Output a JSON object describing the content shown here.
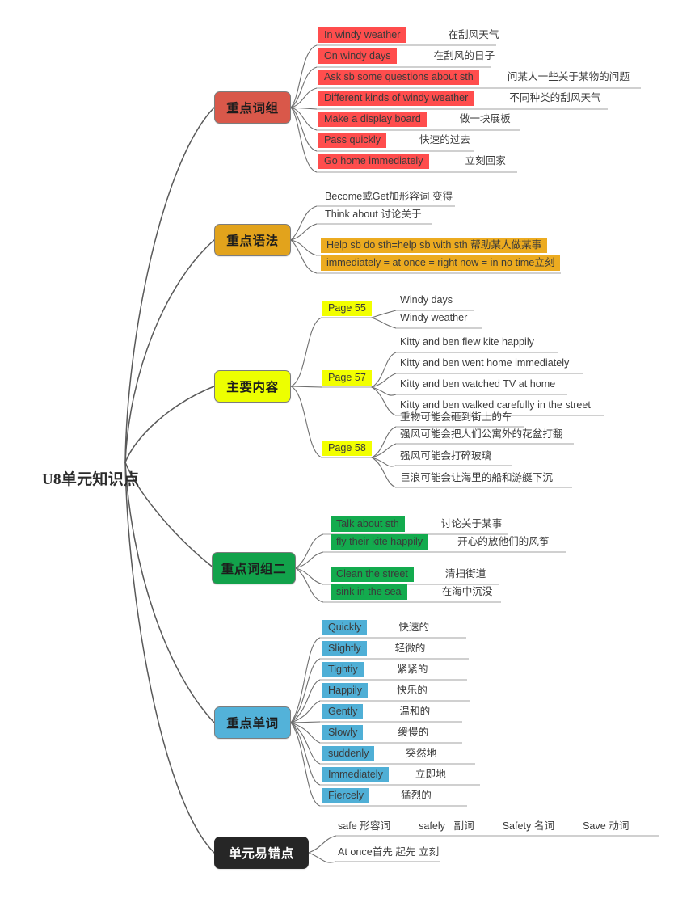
{
  "root": {
    "label": "U8单元知识点"
  },
  "palette": {
    "red_node": "#D9584A",
    "orange_node": "#E2A31C",
    "yellow_node": "#EDFF00",
    "green_node": "#12A24B",
    "blue_node": "#53B2D9",
    "black_node": "#262626",
    "red_highlight": "#FF4D4D",
    "orange_highlight": "#ECAB20",
    "yellow_highlight": "#F2FF00",
    "green_highlight": "#13AB4E",
    "blue_highlight": "#4FAFD6",
    "line": "#6b6b6b",
    "underline": "#9a9a9a",
    "text": "#3b3b3b"
  },
  "branches": [
    {
      "id": "key-phrases",
      "title": "重点词组",
      "items": [
        {
          "en": "In windy weather",
          "cn": "在刮风天气"
        },
        {
          "en": "On windy days",
          "cn": "在刮风的日子"
        },
        {
          "en": "Ask sb some questions about sth",
          "cn": "问某人一些关于某物的问题"
        },
        {
          "en": "Different kinds of windy weather",
          "cn": "不同种类的刮风天气"
        },
        {
          "en": "Make a display  board",
          "cn": "做一块展板"
        },
        {
          "en": "Pass quickly",
          "cn": "快速的过去"
        },
        {
          "en": "Go home immediately",
          "cn": "立刻回家"
        }
      ]
    },
    {
      "id": "key-grammar",
      "title": "重点语法",
      "items": [
        {
          "en": "Become或Get加形容词 变得",
          "cn": ""
        },
        {
          "en": "Think about 讨论关于",
          "cn": ""
        },
        {
          "en": "Help sb do sth=help sb with sth 帮助某人做某事",
          "cn": ""
        },
        {
          "en": "immediately = at once = right now = in no time立刻",
          "cn": ""
        }
      ]
    },
    {
      "id": "main-content",
      "title": "主要内容",
      "groups": [
        {
          "label": "Page 55",
          "items": [
            {
              "en": "Windy days"
            },
            {
              "en": "Windy weather"
            }
          ]
        },
        {
          "label": "Page 57",
          "items": [
            {
              "en": "Kitty and ben flew kite happily"
            },
            {
              "en": "Kitty and ben went home immediately"
            },
            {
              "en": "Kitty and ben watched TV at home"
            },
            {
              "en": "Kitty and ben walked carefully in the street"
            }
          ]
        },
        {
          "label": "Page 58",
          "items": [
            {
              "en": "重物可能会砸到街上的车"
            },
            {
              "en": "强风可能会把人们公寓外的花盆打翻"
            },
            {
              "en": "强风可能会打碎玻璃"
            },
            {
              "en": "巨浪可能会让海里的船和游艇下沉"
            }
          ]
        }
      ]
    },
    {
      "id": "key-phrases-2",
      "title": "重点词组二",
      "items": [
        {
          "en": "Talk about sth",
          "cn": "讨论关于某事"
        },
        {
          "en": "fly their kite happily",
          "cn": "开心的放他们的风筝"
        },
        {
          "en": "Clean the street",
          "cn": "清扫街道"
        },
        {
          "en": "sink in the sea",
          "cn": "在海中沉没"
        }
      ]
    },
    {
      "id": "key-words",
      "title": "重点单词",
      "items": [
        {
          "en": "Quickly",
          "cn": "快速的"
        },
        {
          "en": "Slightly",
          "cn": "轻微的"
        },
        {
          "en": "Tightiy",
          "cn": "紧紧的"
        },
        {
          "en": "Happily",
          "cn": "快乐的"
        },
        {
          "en": "Gently",
          "cn": "温和的"
        },
        {
          "en": "Slowly",
          "cn": "缓慢的"
        },
        {
          "en": "suddenly",
          "cn": "突然地"
        },
        {
          "en": "Immediately",
          "cn": "立即地"
        },
        {
          "en": "Fiercely",
          "cn": "猛烈的"
        }
      ]
    },
    {
      "id": "error-prone",
      "title": "单元易错点",
      "items": [
        {
          "en": "safe 形容词          safely   副词          Safety 名词          Save 动词",
          "cn": ""
        },
        {
          "en": "At once首先 起先 立刻",
          "cn": ""
        }
      ]
    }
  ]
}
